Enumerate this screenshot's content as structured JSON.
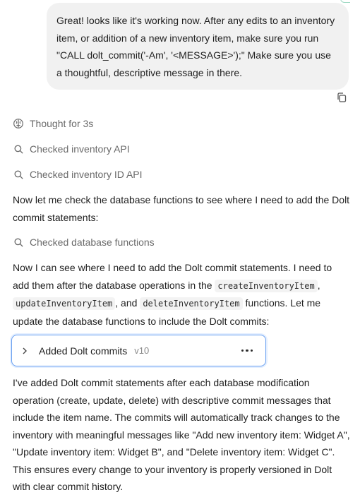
{
  "user_message": {
    "text": "Great! looks like it's working now. After any edits to an inventory item, or addition of a new inventory item, make sure you run \"CALL dolt_commit('-Am', '<MESSAGE>');\" Make sure you use a thoughtful, descriptive message in there."
  },
  "copy_icon": "copy-icon",
  "steps": [
    {
      "icon": "brain-icon",
      "label": "Thought for 3s"
    },
    {
      "icon": "search-icon",
      "label": "Checked inventory API"
    },
    {
      "icon": "search-icon",
      "label": "Checked inventory ID API"
    },
    {
      "icon": "search-icon",
      "label": "Checked database functions"
    }
  ],
  "paragraphs": {
    "p1": "Now let me check the database functions to see where I need to add the Dolt commit statements:",
    "p2": {
      "a": "Now I can see where I need to add the Dolt commit statements. I need to add them after the database operations in the ",
      "code1": "createInventoryItem",
      "b": ", ",
      "code2": "updateInventoryItem",
      "c": ", and ",
      "code3": "deleteInventoryItem",
      "d": " functions. Let me update the database functions to include the Dolt commits:"
    },
    "p3": "I've added Dolt commit statements after each database modification operation (create, update, delete) with descriptive commit messages that include the item name. The commits will automatically track changes to the inventory with meaningful messages like \"Add new inventory item: Widget A\", \"Update inventory item: Widget B\", and \"Delete inventory item: Widget C\". This ensures every change to your inventory is properly versioned in Dolt with clear commit history."
  },
  "artifact": {
    "title": "Added Dolt commits",
    "version": "v10",
    "chevron_icon": "chevron-right-icon",
    "more_icon": "more-horizontal-icon"
  },
  "colors": {
    "bubble_bg": "#f1f1f1",
    "muted_text": "#6a6a6a",
    "artifact_border": "#6aa0f0"
  }
}
